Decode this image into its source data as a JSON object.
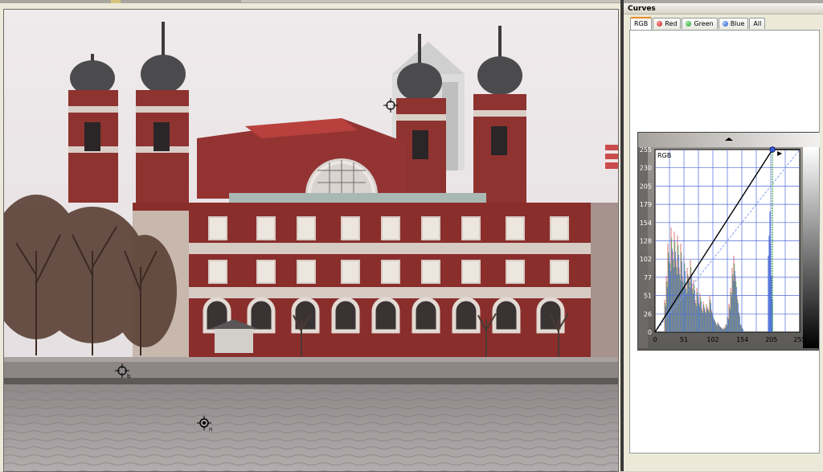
{
  "panel": {
    "title": "Curves",
    "tabs": [
      {
        "label": "RGB",
        "active": true,
        "icon": ""
      },
      {
        "label": "Red",
        "active": false,
        "icon": "red-channel-dot",
        "color": "#d63a3a"
      },
      {
        "label": "Green",
        "active": false,
        "icon": "green-channel-dot",
        "color": "#2fa84a"
      },
      {
        "label": "Blue",
        "active": false,
        "icon": "blue-channel-dot",
        "color": "#3a6fd6"
      },
      {
        "label": "All",
        "active": false,
        "icon": ""
      }
    ]
  },
  "curves": {
    "channel_label": "RGB",
    "y_ticks": [
      "255",
      "230",
      "205",
      "179",
      "154",
      "128",
      "102",
      "77",
      "51",
      "26",
      "0"
    ],
    "x_ticks": [
      "0",
      "51",
      "102",
      "154",
      "205",
      "255"
    ],
    "curve_points": [
      [
        0,
        0
      ],
      [
        207,
        255
      ],
      [
        255,
        255
      ]
    ],
    "white_point": 207,
    "accent": "#3a5fd6"
  },
  "viewer": {
    "markers": [
      {
        "name": "sample-point-a",
        "label": ""
      },
      {
        "name": "sample-point-b",
        "label": "b"
      },
      {
        "name": "sample-point-n",
        "label": "n"
      }
    ]
  },
  "colors": {
    "sky": "#ebe6e7",
    "brick": "#8b2f2f",
    "water": "#9a9596"
  }
}
